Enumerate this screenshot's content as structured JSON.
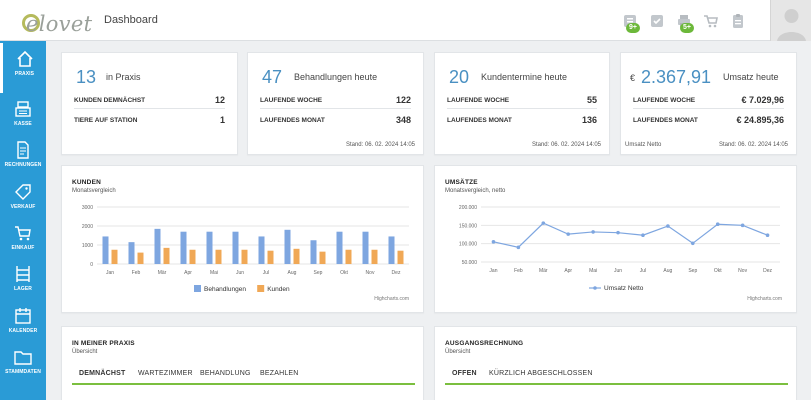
{
  "header": {
    "logo": "elovet",
    "title": "Dashboard",
    "badges": [
      "9+",
      "5+"
    ],
    "icons": [
      "tasks-icon",
      "check-icon",
      "printer-icon",
      "cart-icon",
      "clipboard-icon"
    ]
  },
  "sidebar": {
    "items": [
      {
        "label": "PRAXIS",
        "icon": "home-icon"
      },
      {
        "label": "KASSE",
        "icon": "cash-register-icon"
      },
      {
        "label": "RECHNUNGEN",
        "icon": "invoice-icon"
      },
      {
        "label": "VERKAUF",
        "icon": "tag-icon"
      },
      {
        "label": "EINKAUF",
        "icon": "cart-icon"
      },
      {
        "label": "LAGER",
        "icon": "shelf-icon"
      },
      {
        "label": "KALENDER",
        "icon": "calendar-icon"
      },
      {
        "label": "STAMMDATEN",
        "icon": "folder-icon"
      }
    ]
  },
  "stats": [
    {
      "value": "13",
      "caption": "in Praxis",
      "rows": [
        {
          "label": "KUNDEN DEMNÄCHST",
          "value": "12"
        },
        {
          "label": "TIERE AUF STATION",
          "value": "1"
        }
      ],
      "footer": ""
    },
    {
      "value": "47",
      "caption": "Behandlungen heute",
      "rows": [
        {
          "label": "LAUFENDE WOCHE",
          "value": "122"
        },
        {
          "label": "LAUFENDES MONAT",
          "value": "348"
        }
      ],
      "footer": "Stand: 06. 02. 2024 14:05"
    },
    {
      "value": "20",
      "caption": "Kundentermine heute",
      "rows": [
        {
          "label": "LAUFENDE WOCHE",
          "value": "55"
        },
        {
          "label": "LAUFENDES MONAT",
          "value": "136"
        }
      ],
      "footer": "Stand: 06. 02. 2024 14:05"
    },
    {
      "currency": "€",
      "value": "2.367,91",
      "caption": "Umsatz heute",
      "rows": [
        {
          "label": "LAUFENDE WOCHE",
          "value": "€ 7.029,96"
        },
        {
          "label": "LAUFENDES MONAT",
          "value": "€ 24.895,36"
        }
      ],
      "footer_left": "Umsatz Netto",
      "footer": "Stand: 06. 02. 2024 14:05"
    }
  ],
  "kunden_panel": {
    "title": "KUNDEN",
    "subtitle": "Monatsvergleich",
    "credit": "Highcharts.com"
  },
  "umsatz_panel": {
    "title": "UMSÄTZE",
    "subtitle": "Monatsvergleich, netto",
    "credit": "Highcharts.com"
  },
  "praxis_panel": {
    "title": "IN MEINER PRAXIS",
    "subtitle": "Übersicht",
    "tabs": [
      "DEMNÄCHST",
      "WARTEZIMMER",
      "BEHANDLUNG",
      "BEZAHLEN"
    ]
  },
  "rechnung_panel": {
    "title": "AUSGANGSRECHNUNG",
    "subtitle": "Übersicht",
    "tabs": [
      "OFFEN",
      "KÜRZLICH ABGESCHLOSSEN"
    ]
  },
  "chart_data": [
    {
      "type": "bar",
      "categories": [
        "Jan",
        "Feb",
        "Mär",
        "Apr",
        "Mai",
        "Jun",
        "Jul",
        "Aug",
        "Sep",
        "Okt",
        "Nov",
        "Dez"
      ],
      "series": [
        {
          "name": "Behandlungen",
          "color": "#7ea6e0",
          "values": [
            1450,
            1150,
            1850,
            1700,
            1700,
            1700,
            1450,
            1800,
            1250,
            1700,
            1700,
            1450
          ]
        },
        {
          "name": "Kunden",
          "color": "#f0a856",
          "values": [
            750,
            600,
            850,
            750,
            750,
            750,
            700,
            800,
            650,
            750,
            750,
            700
          ]
        }
      ],
      "ylim": [
        0,
        3000
      ],
      "yticks": [
        "3000",
        "2000",
        "1000",
        "0"
      ],
      "legend": "bottom-center"
    },
    {
      "type": "line",
      "categories": [
        "Jan",
        "Feb",
        "Mär",
        "Apr",
        "Mai",
        "Jun",
        "Jul",
        "Aug",
        "Sep",
        "Okt",
        "Nov",
        "Dez"
      ],
      "series": [
        {
          "name": "Umsatz Netto",
          "color": "#7ea6e0",
          "values": [
            105000,
            90000,
            156000,
            126000,
            132000,
            130000,
            123000,
            148000,
            101000,
            153000,
            150000,
            123000
          ]
        }
      ],
      "ylim": [
        50000,
        200000
      ],
      "yticks": [
        "200.000",
        "150.000",
        "100.000",
        "50.000"
      ],
      "legend": "bottom-center"
    }
  ]
}
